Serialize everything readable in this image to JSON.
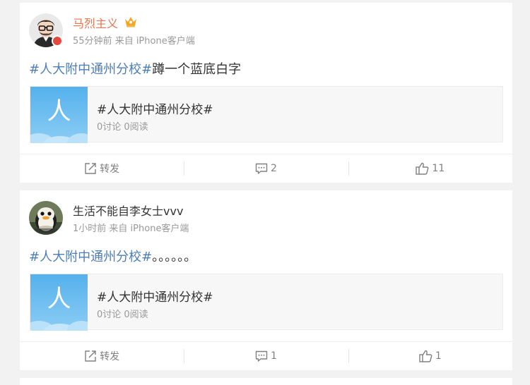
{
  "colors": {
    "background": "#f2f2f2",
    "card": "#ffffff",
    "hashtag": "#4d7eb8",
    "vip_name": "#eb7350",
    "muted": "#999999",
    "topic_thumb_top": "#5ab5ee",
    "topic_thumb_bottom": "#9dd4f7"
  },
  "posts": [
    {
      "username": "马烈主义",
      "time": "55分钟前",
      "source": "来自 iPhone客户端",
      "hashtag": "#人大附中通州分校#",
      "text": "蹲一个蓝底白字",
      "topic": {
        "thumb_char": "人",
        "title": "#人大附中通州分校#",
        "stats": "0讨论 0阅读"
      },
      "actions": {
        "repost_label": "转发",
        "comment_count": "2",
        "like_count": "11"
      },
      "icons": [
        "avatar-man-glasses",
        "vip-crown-icon",
        "verified-badge-icon"
      ]
    },
    {
      "username": "生活不能自李女士vvv",
      "time": "1小时前",
      "source": "来自 iPhone客户端",
      "hashtag": "#人大附中通州分校#",
      "text": "。。。。。。",
      "topic": {
        "thumb_char": "人",
        "title": "#人大附中通州分校#",
        "stats": "0讨论 0阅读"
      },
      "actions": {
        "repost_label": "转发",
        "comment_count": "1",
        "like_count": "1"
      },
      "icons": [
        "avatar-penguin"
      ]
    }
  ]
}
